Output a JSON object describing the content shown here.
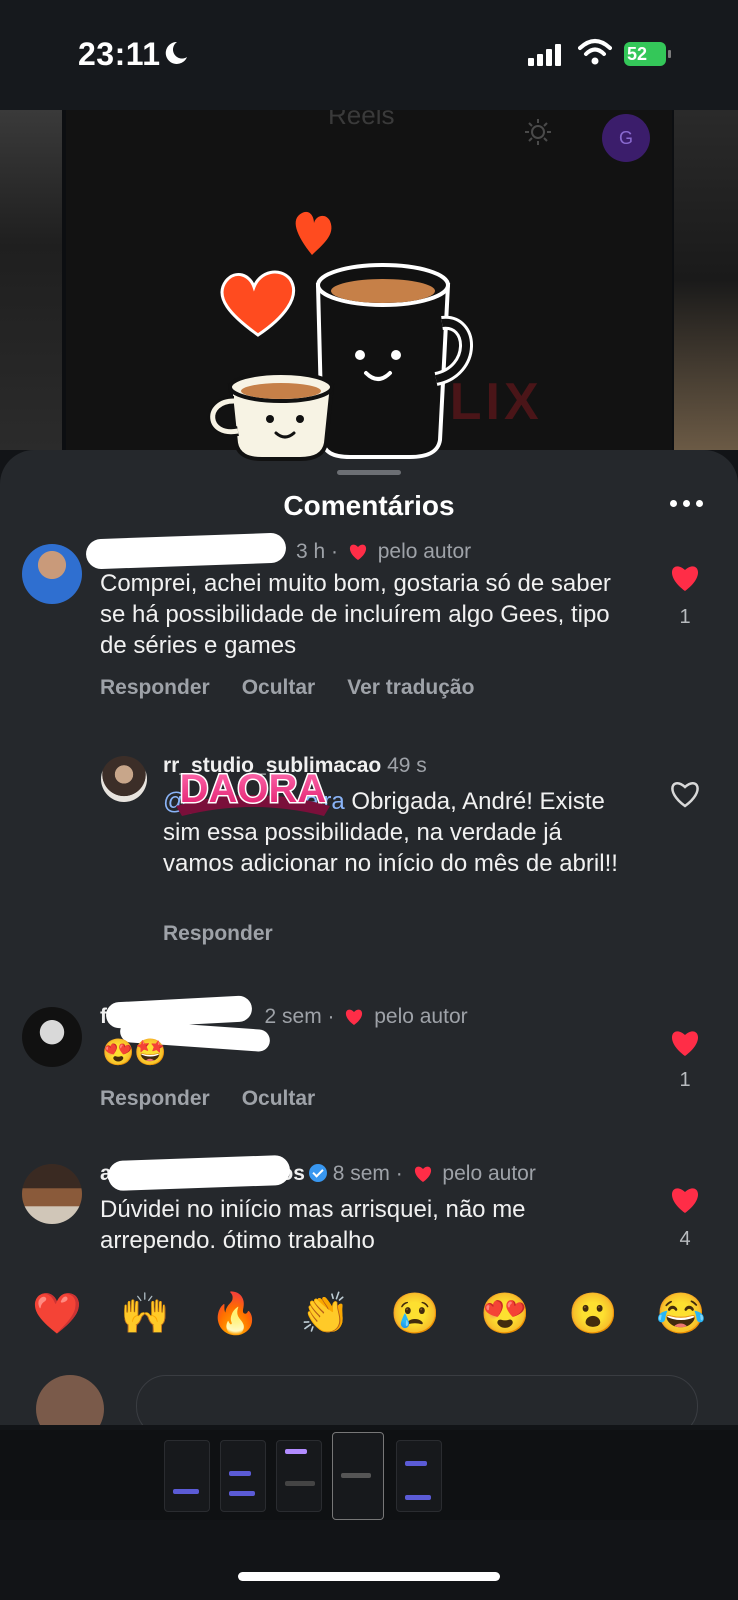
{
  "status": {
    "time": "23:11",
    "battery": "52"
  },
  "background": {
    "title": "Reels",
    "avatar_letter": "G",
    "video_text": "STICKFLIX"
  },
  "sheet": {
    "title": "Comentários"
  },
  "comments": [
    {
      "meta_time": "3 h",
      "liked_by": "pelo autor",
      "text": "Comprei, achei muito bom, gostaria só de saber se há possibilidade de incluírem algo Gees, tipo de séries e games",
      "actions": [
        "Responder",
        "Ocultar",
        "Ver tradução"
      ],
      "like_count": "1"
    },
    {
      "user": "rr_studio_sublimacao",
      "meta_time": "49 s",
      "mention_visible": "@p",
      "mention_tail": "eira",
      "text": " Obrigada, André! Existe sim essa possibilidade, na verdade já vamos adicionar no início do mês de abril!!",
      "actions": [
        "Responder"
      ],
      "sticker_text": "DAORA"
    },
    {
      "user_initial": "fi",
      "meta_time": "2 sem",
      "liked_by": "pelo autor",
      "text": "😍🤩",
      "actions": [
        "Responder",
        "Ocultar"
      ],
      "like_count": "1"
    },
    {
      "user_initial": "a",
      "user_tail": "tos",
      "meta_time": "8 sem",
      "liked_by": "pelo autor",
      "text": "Dúvidei no iniício mas arrisquei, não me arrependo. ótimo trabalho",
      "like_count": "4"
    }
  ],
  "reactions": [
    "❤️",
    "🙌",
    "🔥",
    "👏",
    "😢",
    "😍",
    "😮",
    "😂"
  ],
  "colors": {
    "heart": "#ff2d47",
    "sheet": "#25282c",
    "accent_blue": "#3897f0"
  }
}
